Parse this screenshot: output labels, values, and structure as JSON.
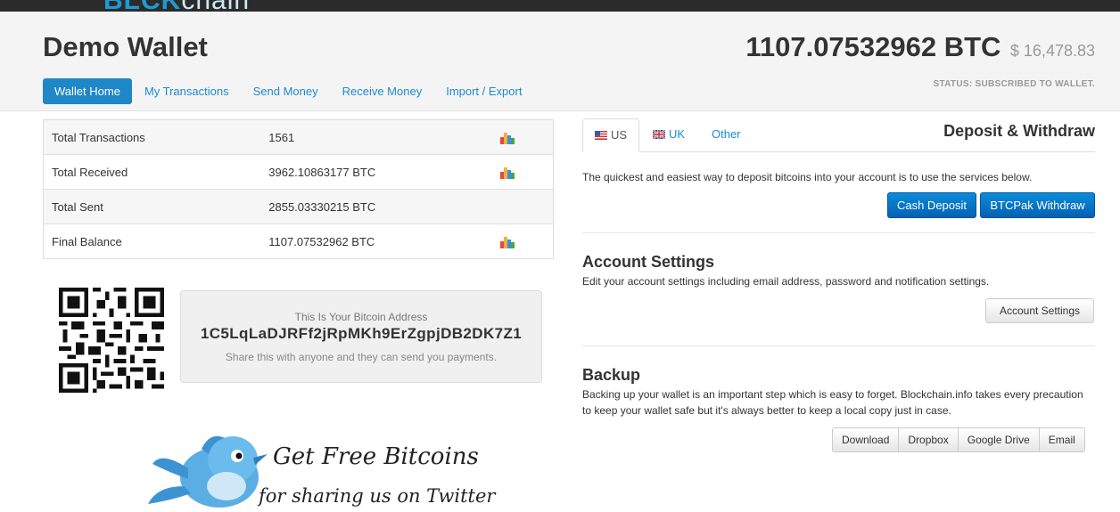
{
  "brand": {
    "logo_main": "BL",
    "logo_mid": "CK",
    "logo_rest": "chain"
  },
  "header": {
    "title": "Demo Wallet",
    "balance_btc": "1107.07532962 BTC",
    "balance_usd": "$ 16,478.83",
    "status": "STATUS: SUBSCRIBED TO WALLET."
  },
  "nav": [
    {
      "label": "Wallet Home",
      "active": true
    },
    {
      "label": "My Transactions"
    },
    {
      "label": "Send Money"
    },
    {
      "label": "Receive Money"
    },
    {
      "label": "Import / Export"
    }
  ],
  "stats": [
    {
      "label": "Total Transactions",
      "value": "1561",
      "chart_icon": true
    },
    {
      "label": "Total Received",
      "value": "3962.10863177 BTC",
      "chart_icon": true
    },
    {
      "label": "Total Sent",
      "value": "2855.03330215 BTC",
      "chart_icon": false
    },
    {
      "label": "Final Balance",
      "value": "1107.07532962 BTC",
      "chart_icon": true
    }
  ],
  "address": {
    "label": "This Is Your Bitcoin Address",
    "value": "1C5LqLaDJRFf2jRpMKh9ErZgpjDB2DK7Z1",
    "hint": "Share this with anyone and they can send you payments."
  },
  "promo": {
    "line1": "Get Free Bitcoins",
    "line2": "for sharing us on Twitter"
  },
  "deposit": {
    "tabs": [
      {
        "label": "US",
        "icon": "us-flag-icon",
        "active": true
      },
      {
        "label": "UK",
        "icon": "uk-flag-icon"
      },
      {
        "label": "Other"
      }
    ],
    "title": "Deposit & Withdraw",
    "text": "The quickest and easiest way to deposit bitcoins into your account is to use the services below.",
    "btn_cash": "Cash Deposit",
    "btn_btcpak": "BTCPak Withdraw"
  },
  "account": {
    "title": "Account Settings",
    "text": "Edit your account settings including email address, password and notification settings.",
    "button": "Account Settings"
  },
  "backup": {
    "title": "Backup",
    "text": "Backing up your wallet is an important step which is easy to forget. Blockchain.info takes every precaution to keep your wallet safe but it's always better to keep a local copy just in case.",
    "buttons": [
      "Download",
      "Dropbox",
      "Google Drive",
      "Email"
    ]
  },
  "colors": {
    "accent": "#1e87c8",
    "link": "#1d8ad0",
    "primary_btn": "#0560b5"
  }
}
